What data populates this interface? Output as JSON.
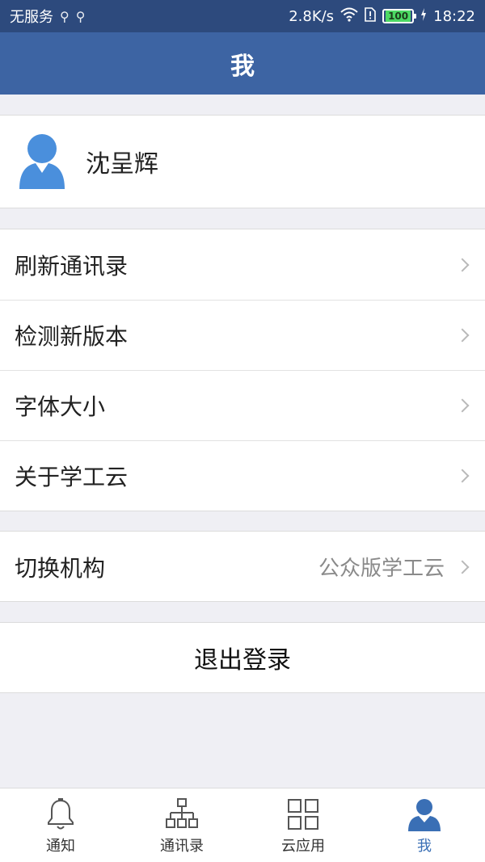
{
  "status_bar": {
    "carrier": "无服务",
    "usb_icons": [
      "usb-icon",
      "usb-icon"
    ],
    "speed": "2.8K/s",
    "battery": "100",
    "time": "18:22"
  },
  "header": {
    "title": "我"
  },
  "profile": {
    "name": "沈呈辉"
  },
  "menu": {
    "items": [
      {
        "label": "刷新通讯录"
      },
      {
        "label": "检测新版本"
      },
      {
        "label": "字体大小"
      },
      {
        "label": "关于学工云"
      }
    ]
  },
  "org": {
    "label": "切换机构",
    "value": "公众版学工云"
  },
  "logout": {
    "label": "退出登录"
  },
  "tabbar": {
    "tabs": [
      {
        "label": "通知",
        "icon": "bell-icon"
      },
      {
        "label": "通讯录",
        "icon": "org-chart-icon"
      },
      {
        "label": "云应用",
        "icon": "grid-icon"
      },
      {
        "label": "我",
        "icon": "person-icon",
        "active": true
      }
    ]
  },
  "colors": {
    "header": "#3d64a3",
    "status_bar": "#2d4a7d",
    "active_tab": "#3a6fb5",
    "avatar": "#4a8fdc"
  }
}
